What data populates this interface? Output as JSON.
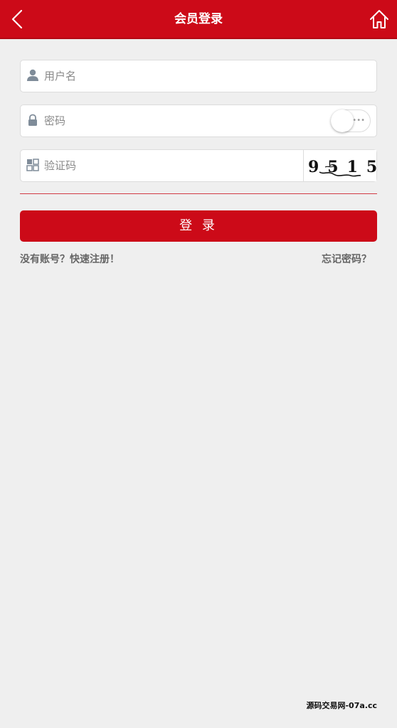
{
  "header": {
    "title": "会员登录",
    "back_icon": "chevron-left-icon",
    "home_icon": "home-icon",
    "background_color": "#cc0a18"
  },
  "form": {
    "username": {
      "placeholder": "用户名",
      "value": "",
      "icon": "user-icon"
    },
    "password": {
      "placeholder": "密码",
      "value": "",
      "icon": "lock-icon",
      "show_password_toggle": "off"
    },
    "captcha": {
      "placeholder": "验证码",
      "value": "",
      "icon": "grid-icon",
      "image_text": "9515"
    },
    "login_label": "登 录"
  },
  "links": {
    "register": "没有账号？快速注册！",
    "forgot_password": "忘记密码？"
  },
  "watermark": "源码交易网-07a.cc"
}
